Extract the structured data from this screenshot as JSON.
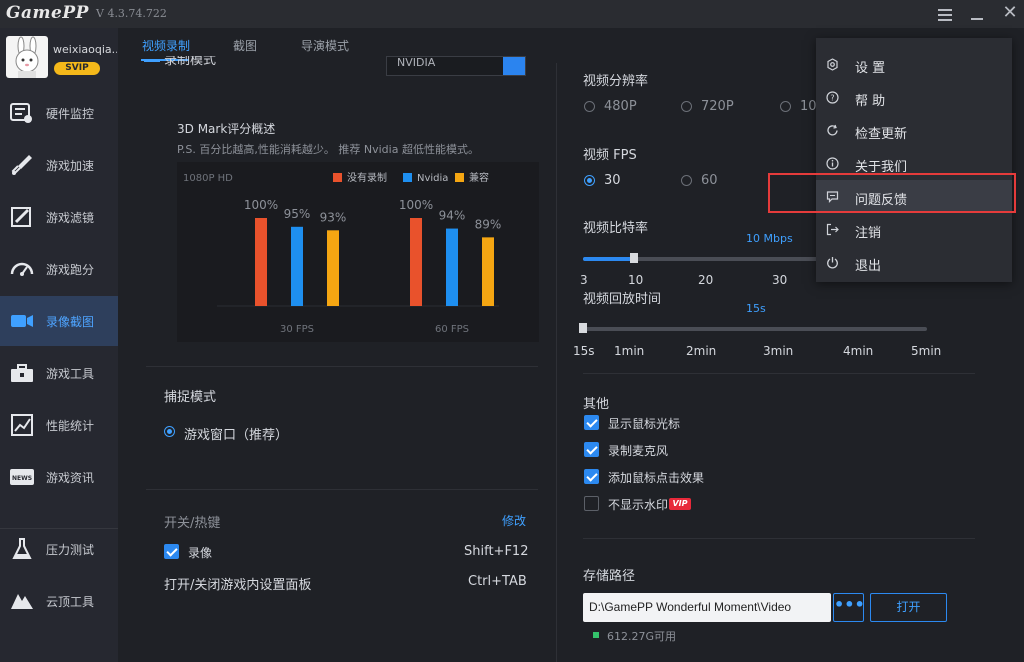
{
  "app": {
    "title": "GamePP",
    "version": "V 4.3.74.722"
  },
  "user": {
    "name": "weixiaoqia...",
    "badge": "SVIP"
  },
  "sidebar": {
    "items": [
      {
        "label": "硬件监控",
        "icon": "hardware-monitor-icon"
      },
      {
        "label": "游戏加速",
        "icon": "rocket-icon"
      },
      {
        "label": "游戏滤镜",
        "icon": "filter-icon"
      },
      {
        "label": "游戏跑分",
        "icon": "speedometer-icon"
      },
      {
        "label": "录像截图",
        "icon": "video-camera-icon",
        "active": true
      },
      {
        "label": "游戏工具",
        "icon": "toolbox-icon"
      },
      {
        "label": "性能统计",
        "icon": "chart-icon"
      },
      {
        "label": "游戏资讯",
        "icon": "news-icon"
      },
      {
        "label": "压力测试",
        "icon": "flask-icon"
      },
      {
        "label": "云顶工具",
        "icon": "mountain-icon"
      }
    ]
  },
  "tabs": [
    "视频录制",
    "截图",
    "导演模式"
  ],
  "left": {
    "partial_label": "录制模式",
    "encoder_value": "NVIDIA",
    "chart_title": "3D Mark评分概述",
    "chart_subtitle": "P.S. 百分比越高,性能消耗越少。 推荐 Nvidia 超低性能模式。",
    "capture_title": "捕捉模式",
    "capture_option": "游戏窗口（推荐）",
    "hotkey_title": "开关/热键",
    "hotkey_edit": "修改",
    "hotkey_record_label": "录像",
    "hotkey_record_value": "Shift+F12",
    "hotkey_panel_label": "打开/关闭游戏内设置面板",
    "hotkey_panel_value": "Ctrl+TAB"
  },
  "chart_data": {
    "type": "bar",
    "corner_label": "1080P HD",
    "categories": [
      "30 FPS",
      "60 FPS"
    ],
    "series": [
      {
        "name": "没有录制",
        "values": [
          100,
          100
        ],
        "color": "#e9522c"
      },
      {
        "name": "Nvidia",
        "values": [
          95,
          94
        ],
        "color": "#1e8ff0"
      },
      {
        "name": "兼容",
        "values": [
          93,
          89
        ],
        "color": "#f5a612"
      }
    ],
    "value_labels": [
      [
        "100%",
        "95%",
        "93%"
      ],
      [
        "100%",
        "94%",
        "89%"
      ]
    ],
    "ylim": [
      0,
      100
    ],
    "legend_position": "top-right",
    "grid": false
  },
  "right": {
    "resolution_title": "视频分辨率",
    "resolution_options": [
      "480P",
      "720P",
      "10"
    ],
    "fps_title": "视频 FPS",
    "fps_options": [
      "30",
      "60"
    ],
    "bitrate_title": "视频比特率",
    "bitrate_value": "10 Mbps",
    "bitrate_level": 10,
    "bitrate_ticks": [
      "3",
      "10",
      "20",
      "30"
    ],
    "replay_title": "视频回放时间",
    "replay_value": "15s",
    "replay_ticks": [
      "15s",
      "1min",
      "2min",
      "3min",
      "4min",
      "5min"
    ],
    "other_title": "其他",
    "checkboxes": [
      {
        "label": "显示鼠标光标",
        "checked": true
      },
      {
        "label": "录制麦克风",
        "checked": true
      },
      {
        "label": "添加鼠标点击效果",
        "checked": true
      },
      {
        "label": "不显示水印",
        "checked": false,
        "badge": "VIP"
      }
    ],
    "storage_title": "存储路径",
    "storage_path": "D:\\GamePP Wonderful Moment\\Video",
    "browse_label": "•••",
    "open_label": "打开",
    "free_space": "612.27G可用"
  },
  "menu": {
    "items": [
      {
        "label": "设 置",
        "icon": "settings-icon"
      },
      {
        "label": "帮 助",
        "icon": "help-icon"
      },
      {
        "label": "检查更新",
        "icon": "refresh-icon"
      },
      {
        "label": "关于我们",
        "icon": "info-icon"
      },
      {
        "label": "问题反馈",
        "icon": "feedback-icon",
        "highlight": true
      },
      {
        "label": "注销",
        "icon": "logout-icon"
      },
      {
        "label": "退出",
        "icon": "power-icon"
      }
    ]
  },
  "colors": {
    "accent": "#3fa0ff",
    "highlight_frame": "#e53b3b"
  }
}
